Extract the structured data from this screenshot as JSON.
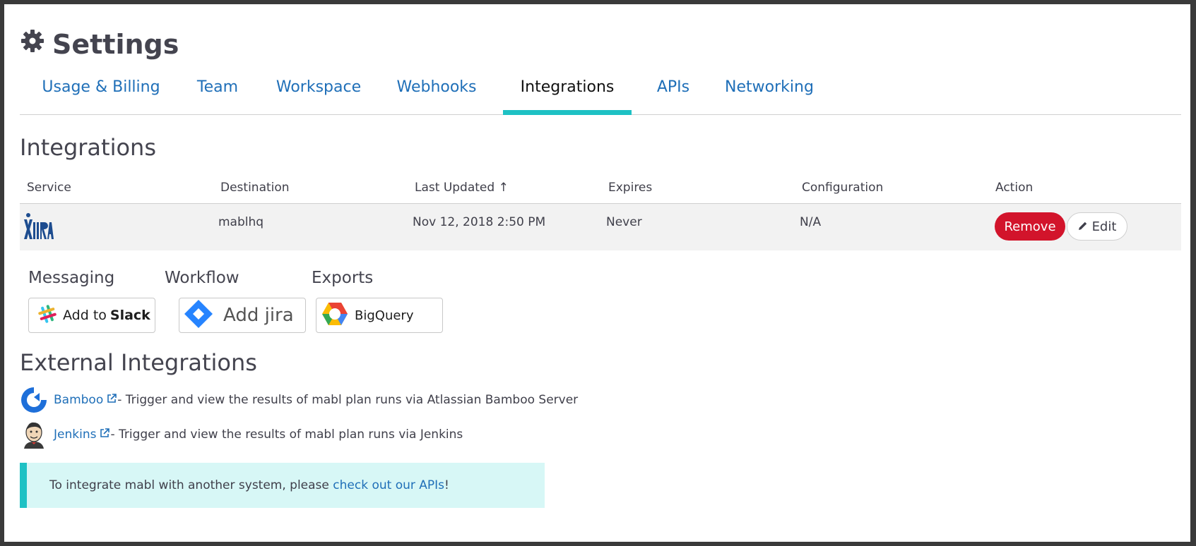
{
  "header": {
    "title": "Settings",
    "icon": "gear-icon"
  },
  "tabs": [
    {
      "label": "Usage & Billing",
      "active": false
    },
    {
      "label": "Team",
      "active": false
    },
    {
      "label": "Workspace",
      "active": false
    },
    {
      "label": "Webhooks",
      "active": false
    },
    {
      "label": "Integrations",
      "active": true
    },
    {
      "label": "APIs",
      "active": false
    },
    {
      "label": "Networking",
      "active": false
    }
  ],
  "integrations": {
    "title": "Integrations",
    "columns": [
      "Service",
      "Destination",
      "Last Updated ↑",
      "Expires",
      "Configuration",
      "Action"
    ],
    "rows": [
      {
        "service_icon": "jira-logo-icon",
        "destination": "mablhq",
        "last_updated": "Nov 12, 2018 2:50 PM",
        "expires": "Never",
        "configuration": "N/A",
        "remove_label": "Remove",
        "edit_label": "Edit"
      }
    ]
  },
  "add_groups": {
    "messaging": {
      "label": "Messaging",
      "button_prefix": "Add to",
      "button_brand": "Slack"
    },
    "workflow": {
      "label": "Workflow",
      "button": "Add jira"
    },
    "exports": {
      "label": "Exports",
      "button": "BigQuery"
    }
  },
  "external": {
    "title": "External Integrations",
    "items": [
      {
        "name": "Bamboo",
        "description": " - Trigger and view the results of mabl plan runs via Atlassian Bamboo Server"
      },
      {
        "name": "Jenkins",
        "description": " - Trigger and view the results of mabl plan runs via Jenkins"
      }
    ]
  },
  "callout": {
    "text_before": "To integrate mabl with another system, please ",
    "link": "check out our APIs",
    "text_after": "!"
  },
  "colors": {
    "accent": "#1ec1c4",
    "link": "#1f6fb8",
    "remove": "#d2142b",
    "callout_bg": "#d7f7f6"
  }
}
